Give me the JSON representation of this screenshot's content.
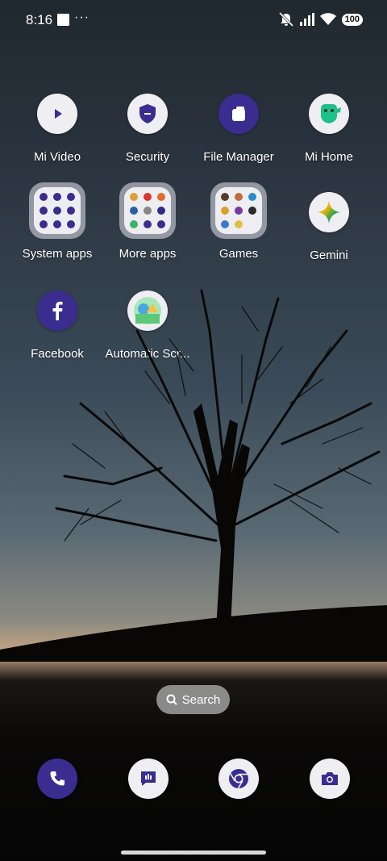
{
  "status_bar": {
    "time": "8:16",
    "more": "···",
    "battery": "100"
  },
  "apps": [
    {
      "label": "Mi Video"
    },
    {
      "label": "Security"
    },
    {
      "label": "File Manager"
    },
    {
      "label": "Mi Home"
    },
    {
      "label": "System apps"
    },
    {
      "label": "More apps"
    },
    {
      "label": "Games"
    },
    {
      "label": "Gemini"
    },
    {
      "label": "Facebook"
    },
    {
      "label": "Automatic Scr..."
    }
  ],
  "search": {
    "label": "Search"
  },
  "dock": [
    "phone-icon",
    "messages-icon",
    "chrome-icon",
    "camera-icon"
  ],
  "colors": {
    "accent": "#3a2d8f",
    "icon_bg": "#efeff3"
  }
}
